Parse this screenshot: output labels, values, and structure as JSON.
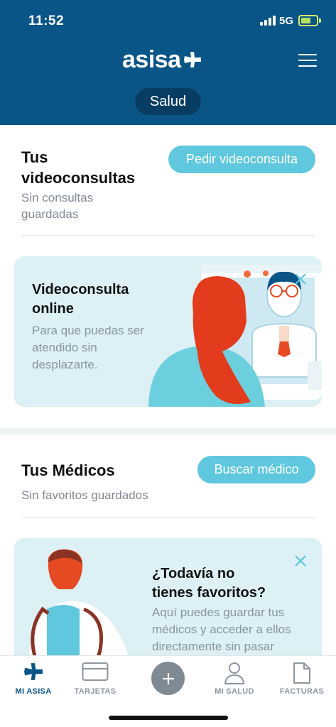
{
  "status_bar": {
    "time": "11:52",
    "network": "5G"
  },
  "header": {
    "logo_text": "asisa",
    "segment_label": "Salud"
  },
  "videoconsultas": {
    "title_line1": "Tus",
    "title_line2": "videoconsultas",
    "subtitle_line1": "Sin consultas",
    "subtitle_line2": "guardadas",
    "button_label": "Pedir videoconsulta",
    "card": {
      "title_line1": "Videoconsulta",
      "title_line2": "online",
      "text_line1": "Para que puedas ser",
      "text_line2": "atendido sin",
      "text_line3": "desplazarte."
    }
  },
  "medicos": {
    "title": "Tus Médicos",
    "subtitle": "Sin favoritos guardados",
    "button_label": "Buscar médico",
    "card": {
      "title_line1": "¿Todavía no",
      "title_line2": "tienes favoritos?",
      "text_line1": "Aquí puedes guardar tus",
      "text_line2": "médicos y acceder a ellos",
      "text_line3": "directamente sin pasar"
    }
  },
  "tabbar": {
    "items": [
      {
        "label": "MI ASISA",
        "icon": "asisa-plane-icon",
        "active": true
      },
      {
        "label": "TARJETAS",
        "icon": "card-icon",
        "active": false
      },
      {
        "label": "",
        "icon": "plus-icon",
        "active": false
      },
      {
        "label": "MI SALUD",
        "icon": "user-icon",
        "active": false
      },
      {
        "label": "FACTURAS",
        "icon": "document-icon",
        "active": false
      }
    ]
  },
  "colors": {
    "header_bg": "#0a5588",
    "accent": "#5fc7de",
    "card_bg": "#dcf0f5",
    "muted_text": "#7f8a94"
  }
}
